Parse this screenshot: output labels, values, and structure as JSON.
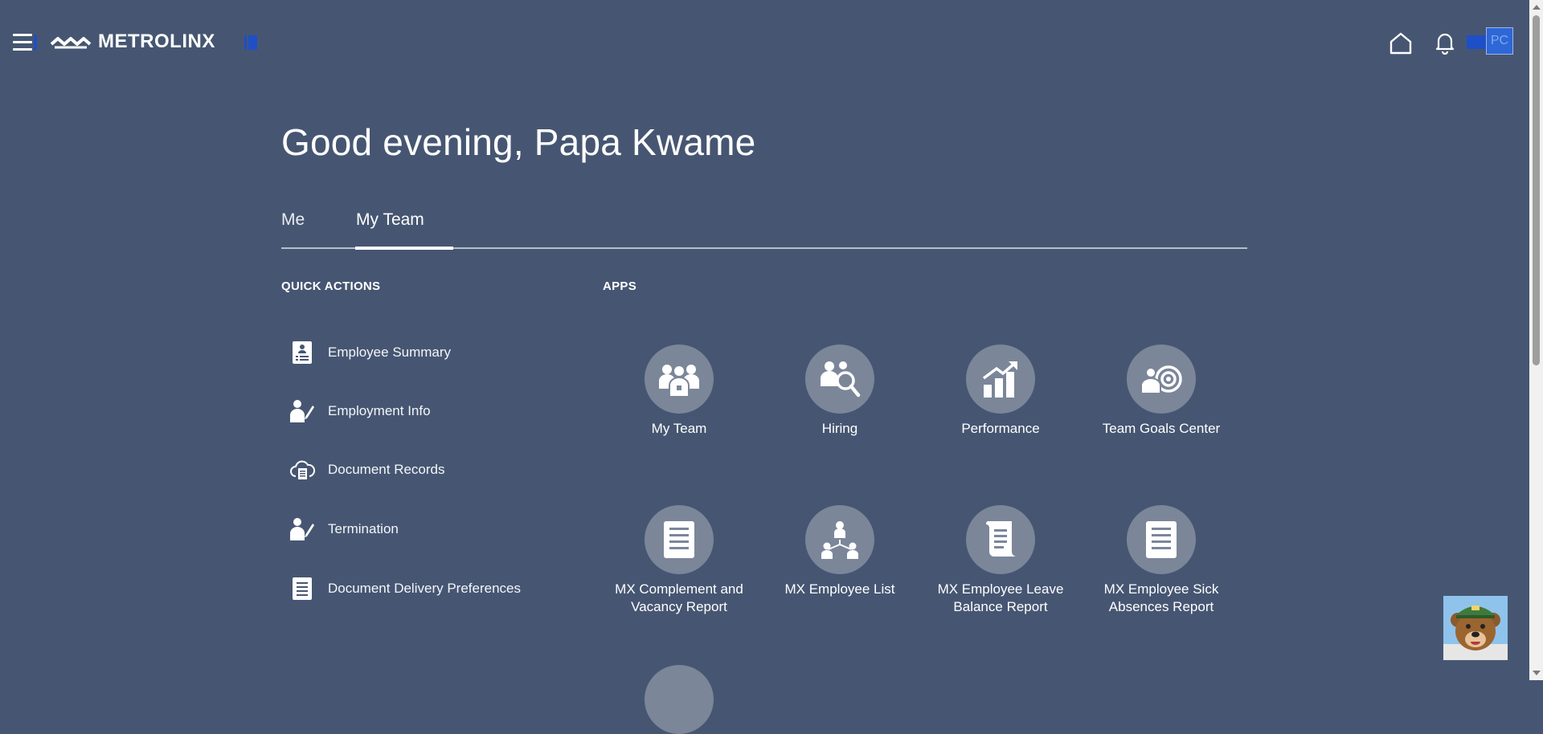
{
  "header": {
    "logo_text": "METROLINX",
    "avatar_initials": "PC"
  },
  "greeting": "Good evening, Papa Kwame",
  "tabs": [
    {
      "label": "Me",
      "active": false
    },
    {
      "label": "My Team",
      "active": true
    }
  ],
  "quick_actions": {
    "title": "QUICK ACTIONS",
    "items": [
      {
        "label": "Employee Summary",
        "icon": "employee-badge-icon"
      },
      {
        "label": "Employment Info",
        "icon": "person-edit-icon"
      },
      {
        "label": "Document Records",
        "icon": "cloud-document-icon"
      },
      {
        "label": "Termination",
        "icon": "person-edit-icon"
      },
      {
        "label": "Document Delivery Preferences",
        "icon": "document-icon"
      }
    ]
  },
  "apps": {
    "title": "APPS",
    "items": [
      {
        "label": "My Team",
        "icon": "team-icon"
      },
      {
        "label": "Hiring",
        "icon": "hiring-search-icon"
      },
      {
        "label": "Performance",
        "icon": "performance-chart-icon"
      },
      {
        "label": "Team Goals Center",
        "icon": "goals-target-icon"
      },
      {
        "label": "MX Complement and Vacancy Report",
        "icon": "report-icon"
      },
      {
        "label": "MX Employee List",
        "icon": "org-chart-icon"
      },
      {
        "label": "MX Employee Leave Balance Report",
        "icon": "scroll-document-icon"
      },
      {
        "label": "MX Employee Sick Absences Report",
        "icon": "report-icon"
      }
    ]
  },
  "colors": {
    "background": "#465672",
    "app_circle": "#7b8699",
    "brand_blue": "#1f4fc7"
  }
}
